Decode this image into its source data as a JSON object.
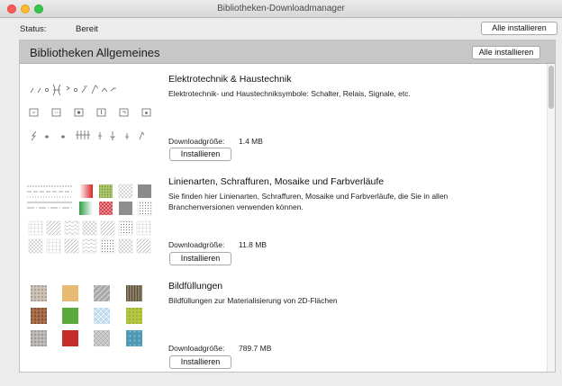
{
  "window": {
    "title": "Bibliotheken-Downloadmanager"
  },
  "status": {
    "label": "Status:",
    "value": "Bereit",
    "install_all_label": "Alle installieren"
  },
  "section": {
    "title": "Bibliotheken Allgemeines",
    "install_all_label": "Alle installieren"
  },
  "libraries": [
    {
      "name": "Elektrotechnik & Haustechnik",
      "description": "Elektrotechnik- und Haustechniksymbole: Schalter, Relais, Signale, etc.",
      "size_label": "Downloadgröße:",
      "size": "1.4 MB",
      "install_label": "Installieren"
    },
    {
      "name": "Linienarten, Schraffuren, Mosaike und Farbverläufe",
      "description": "Sie finden hier Linienarten, Schraffuren, Mosaike und Farbverläufe, die Sie in allen Branchenversionen verwenden können.",
      "size_label": "Downloadgröße:",
      "size": "11.8 MB",
      "install_label": "Installieren"
    },
    {
      "name": "Bildfüllungen",
      "description": "Bildfüllungen zur Materialisierung von 2D-Flächen",
      "size_label": "Downloadgröße:",
      "size": "789.7 MB",
      "install_label": "Installieren"
    }
  ],
  "colors": {
    "close": "#fc5b57",
    "minimize": "#fdbc2e",
    "maximize": "#34c84a",
    "section_header": "#c7c7c7"
  }
}
